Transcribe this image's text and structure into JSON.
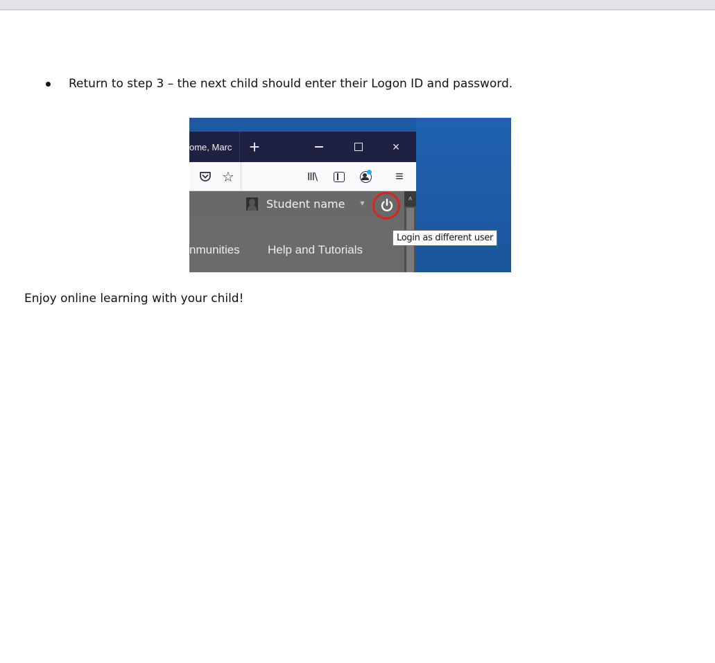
{
  "document": {
    "bullet_text": "Return to step 3 – the next child should enter their Logon ID and password.",
    "closing_text": "Enjoy online learning with your child!"
  },
  "screenshot": {
    "tab_title": "ome, Marc",
    "new_tab_label": "+",
    "close_label": "×",
    "star_glyph": "☆",
    "library_glyph": "III\\",
    "menu_glyph": "≡",
    "user_name": "Student name",
    "dropdown_caret": "▼",
    "scroll_up_glyph": "˄",
    "nav_items": [
      "nmunities",
      "Help and Tutorials"
    ],
    "tooltip": "Login as different user",
    "colors": {
      "desktop": "#1e5aa3",
      "titlebar": "#1f2142",
      "page_bg": "#6b6b6b",
      "highlight_ring": "#d9241c",
      "notification_dot": "#2aa7ff"
    },
    "icons": [
      "pocket-icon",
      "star-icon",
      "library-icon",
      "sidebar-icon",
      "account-icon",
      "menu-icon",
      "avatar-icon",
      "power-icon"
    ]
  }
}
